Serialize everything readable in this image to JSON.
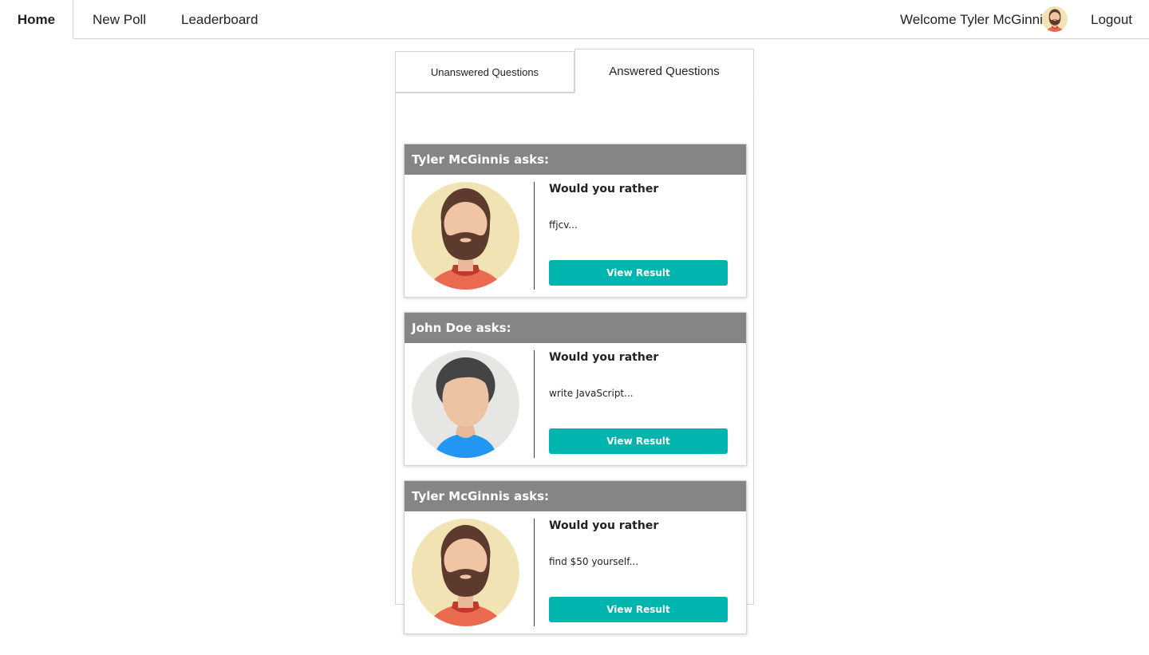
{
  "nav": {
    "home": "Home",
    "new_poll": "New Poll",
    "leaderboard": "Leaderboard",
    "welcome": "Welcome Tyler McGinnis",
    "logout": "Logout"
  },
  "tabs": {
    "unanswered": "Unanswered Questions",
    "answered": "Answered Questions"
  },
  "questions": [
    {
      "author_line": "Tyler McGinnis asks:",
      "title": "Would you rather",
      "preview": "ffjcv...",
      "button": "View Result",
      "avatar": "bearded-man-avatar"
    },
    {
      "author_line": "John Doe asks:",
      "title": "Would you rather",
      "preview": "write JavaScript...",
      "button": "View Result",
      "avatar": "dark-haired-man-avatar"
    },
    {
      "author_line": "Tyler McGinnis asks:",
      "title": "Would you rather",
      "preview": "find $50 yourself...",
      "button": "View Result",
      "avatar": "bearded-man-avatar"
    }
  ],
  "colors": {
    "card_header": "#858585",
    "button": "#00b5ad",
    "border": "#d4d4d5"
  }
}
